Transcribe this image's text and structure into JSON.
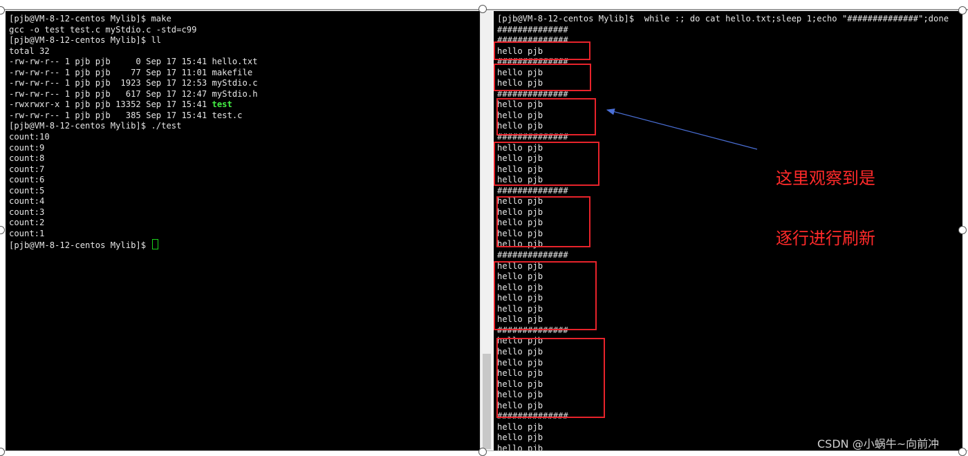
{
  "left_terminal": {
    "lines": [
      "[pjb@VM-8-12-centos Mylib]$ make",
      "gcc -o test test.c myStdio.c -std=c99",
      "[pjb@VM-8-12-centos Mylib]$ ll",
      "total 32",
      "-rw-rw-r-- 1 pjb pjb     0 Sep 17 15:41 hello.txt",
      "-rw-rw-r-- 1 pjb pjb    77 Sep 17 11:01 makefile",
      "-rw-rw-r-- 1 pjb pjb  1923 Sep 17 12:53 myStdio.c",
      "-rw-rw-r-- 1 pjb pjb   617 Sep 17 12:47 myStdio.h",
      "-rwxrwxr-x 1 pjb pjb 13352 Sep 17 15:41 ",
      "-rw-rw-r-- 1 pjb pjb   385 Sep 17 15:41 test.c",
      "[pjb@VM-8-12-centos Mylib]$ ./test",
      "count:10",
      "count:9",
      "count:8",
      "count:7",
      "count:6",
      "count:5",
      "count:4",
      "count:3",
      "count:2",
      "count:1",
      "[pjb@VM-8-12-centos Mylib]$ "
    ],
    "executable_name": "test"
  },
  "right_terminal": {
    "lines": [
      "[pjb@VM-8-12-centos Mylib]$  while :; do cat hello.txt;sleep 1;echo \"##############\";done",
      "##############",
      "##############",
      "hello pjb",
      "##############",
      "hello pjb",
      "hello pjb",
      "##############",
      "hello pjb",
      "hello pjb",
      "hello pjb",
      "##############",
      "hello pjb",
      "hello pjb",
      "hello pjb",
      "hello pjb",
      "##############",
      "hello pjb",
      "hello pjb",
      "hello pjb",
      "hello pjb",
      "hello pjb",
      "##############",
      "hello pjb",
      "hello pjb",
      "hello pjb",
      "hello pjb",
      "hello pjb",
      "hello pjb",
      "##############",
      "hello pjb",
      "hello pjb",
      "hello pjb",
      "hello pjb",
      "hello pjb",
      "hello pjb",
      "hello pjb",
      "##############",
      "hello pjb",
      "hello pjb",
      "hello pjb"
    ]
  },
  "annotation": {
    "line1": "这里观察到是",
    "line2": "逐行进行刷新",
    "color": "#ff2a2a"
  },
  "watermark": "CSDN @小蜗牛~向前冲",
  "colors": {
    "terminal_bg": "#000000",
    "terminal_fg": "#e6e6e6",
    "executable_green": "#44ee44",
    "highlight_box_red": "#e8232b",
    "arrow_blue": "#4a6fd6"
  }
}
